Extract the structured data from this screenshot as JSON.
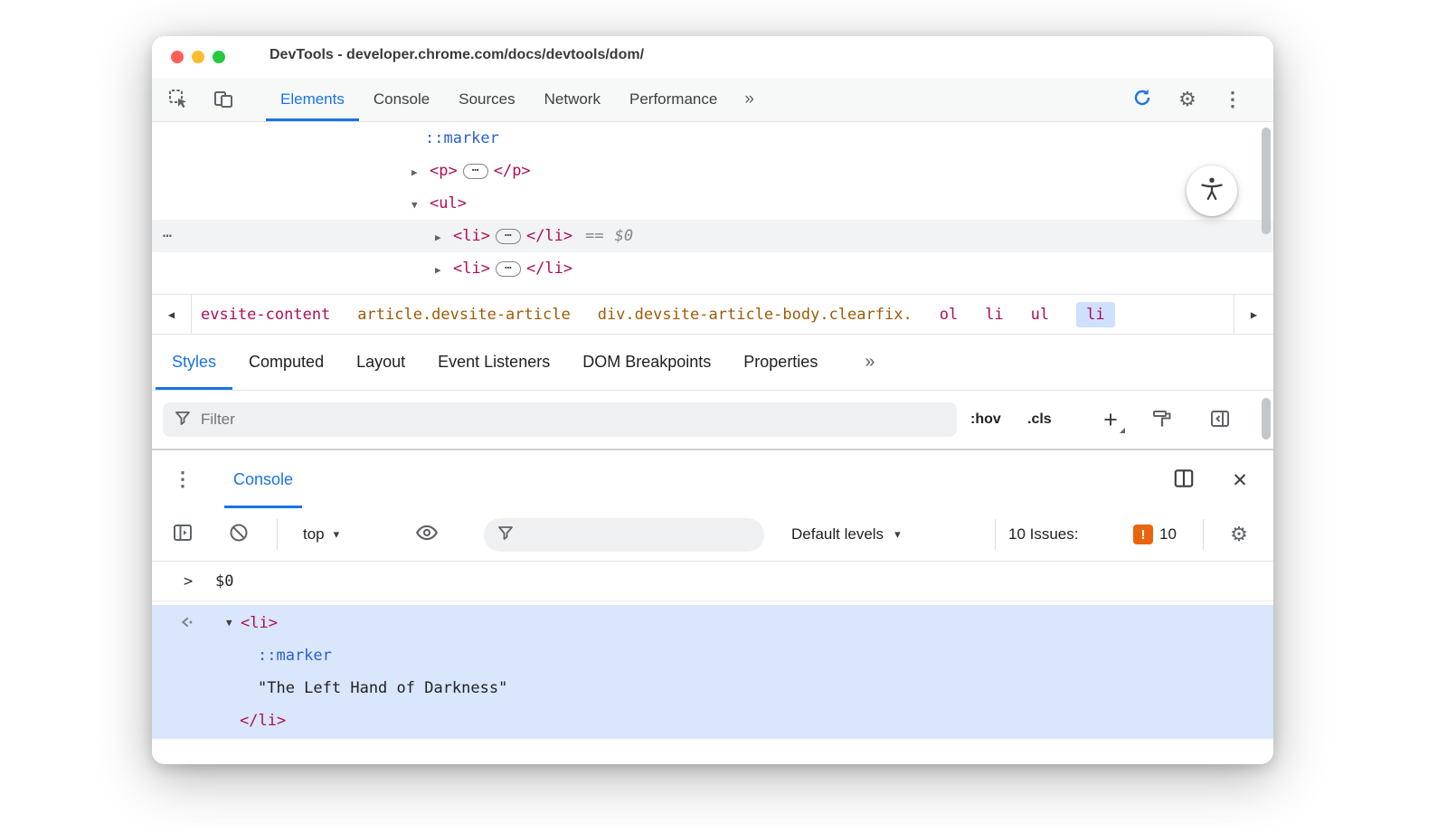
{
  "window": {
    "title": "DevTools - developer.chrome.com/docs/devtools/dom/"
  },
  "icons": {
    "overflow": "»",
    "more_vertical": "⋮",
    "close": "✕",
    "gear": "⚙",
    "dropdown": "▾",
    "expand": "▶",
    "collapse": "▼",
    "crumb_left": "◀",
    "crumb_right": "▶",
    "plus": "+",
    "prompt": ">",
    "issue_exclaim": "!",
    "inline_ellipsis": "⋯",
    "gutter_dots": "⋯"
  },
  "main_tabs": {
    "items": [
      {
        "label": "Elements",
        "active": true
      },
      {
        "label": "Console"
      },
      {
        "label": "Sources"
      },
      {
        "label": "Network"
      },
      {
        "label": "Performance"
      }
    ]
  },
  "dom_tree": {
    "rows": {
      "marker": "::marker",
      "p_open": "<p>",
      "p_close": "</p>",
      "ul_open": "<ul>",
      "li_open": "<li>",
      "li_close": "</li>",
      "eq": "==",
      "ref": "$0"
    }
  },
  "breadcrumbs": {
    "items": [
      {
        "label": "evsite-content"
      },
      {
        "label": "article.devsite-article"
      },
      {
        "label": "div.devsite-article-body.clearfix."
      },
      {
        "label": "ol"
      },
      {
        "label": "li"
      },
      {
        "label": "ul"
      },
      {
        "label": "li",
        "selected": true
      }
    ]
  },
  "sidebar_tabs": {
    "items": [
      {
        "label": "Styles",
        "active": true
      },
      {
        "label": "Computed"
      },
      {
        "label": "Layout"
      },
      {
        "label": "Event Listeners"
      },
      {
        "label": "DOM Breakpoints"
      },
      {
        "label": "Properties"
      }
    ]
  },
  "styles_filter": {
    "placeholder": "Filter",
    "hov": ":hov",
    "cls": ".cls"
  },
  "drawer": {
    "tab_label": "Console"
  },
  "console_toolbar": {
    "context": "top",
    "levels": "Default levels",
    "issues_label": "10 Issues:",
    "issues_count": "10"
  },
  "console": {
    "input": "$0",
    "result": {
      "li_open": "<li>",
      "marker": "::marker",
      "text": "\"The Left Hand of Darkness\"",
      "li_close": "</li>"
    }
  },
  "colors": {
    "accent_blue": "#1a73e8",
    "tag_pink": "#ac0e56",
    "attr_orange": "#9d5b07",
    "pseudo_blue": "#2b5fce",
    "muted_gray": "#5f6368",
    "issue_orange": "#e8650e",
    "result_bg": "#d9e6fc",
    "crumb_selected_bg": "#cfe0fc",
    "row_highlight": "#f1f3f4",
    "traffic_red": "#ff5f57",
    "traffic_yellow": "#febc2e",
    "traffic_green": "#28c840"
  }
}
